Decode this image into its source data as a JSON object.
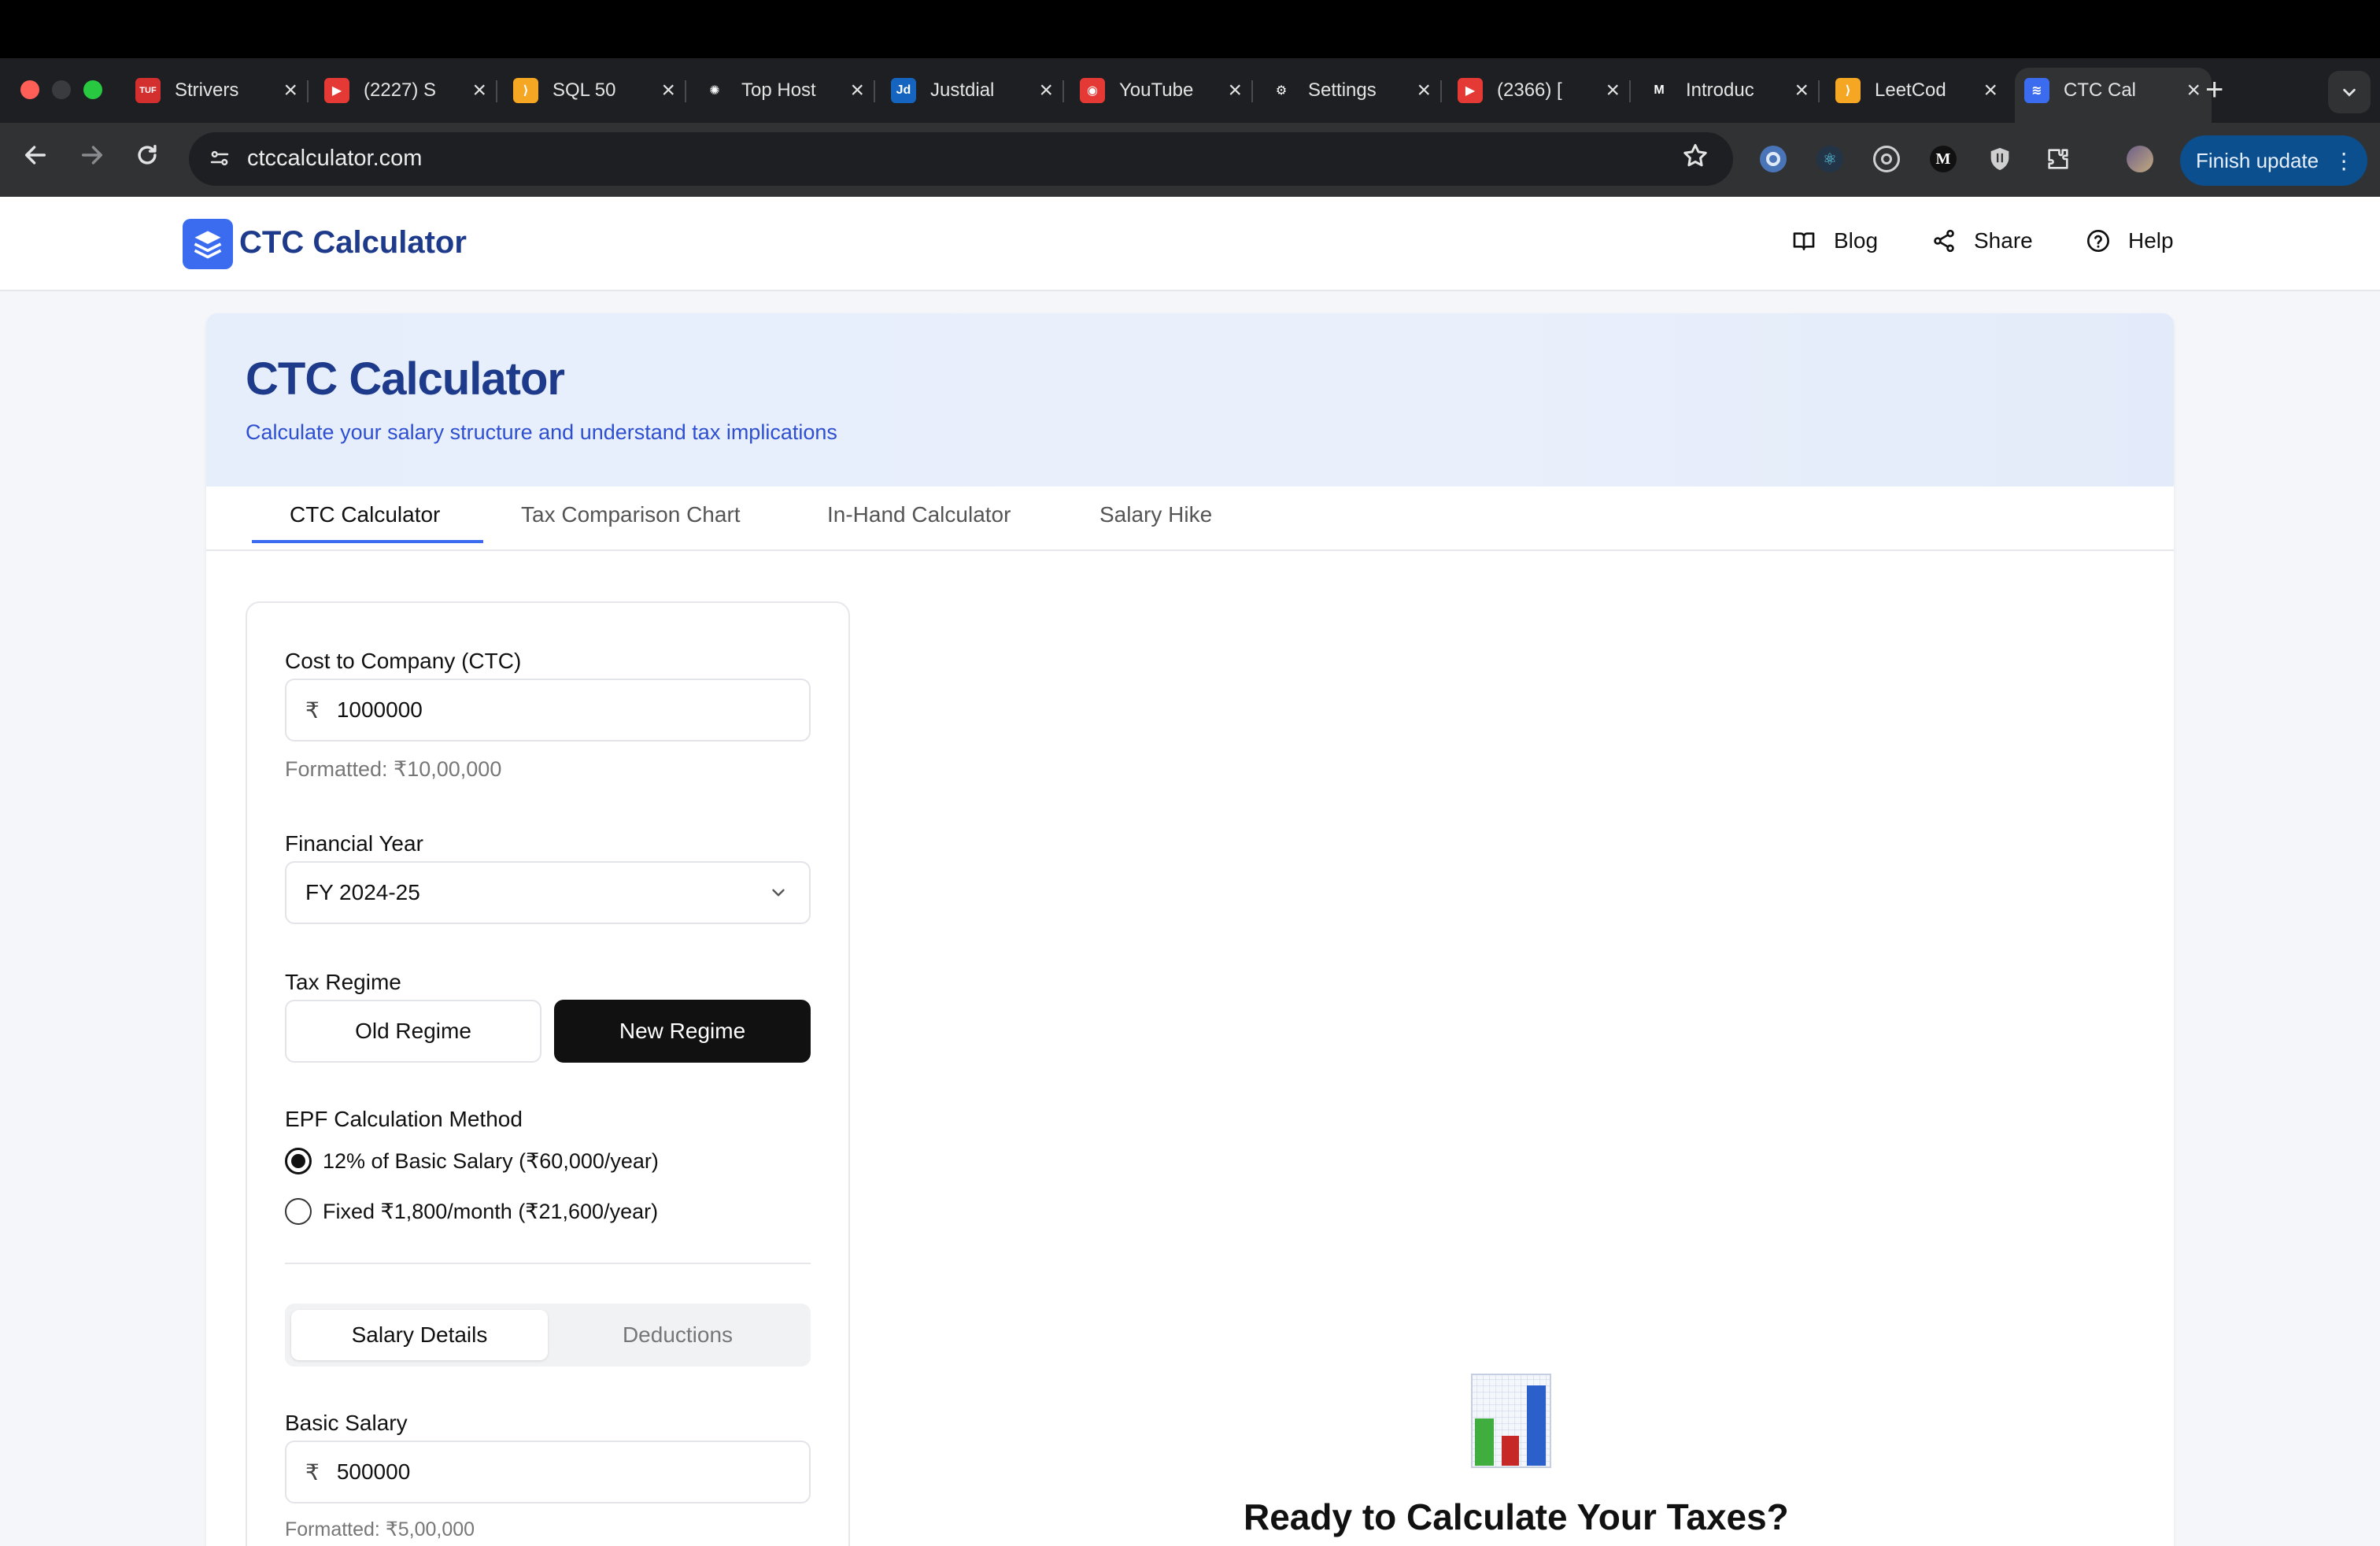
{
  "browser": {
    "tabs": [
      {
        "label": "Strivers",
        "icon": "tuf-icon",
        "color": "#d32f2f"
      },
      {
        "label": "(2227) S",
        "icon": "youtube-icon",
        "color": "#e53935"
      },
      {
        "label": "SQL 50",
        "icon": "leetcode-icon",
        "color": "#f5a623"
      },
      {
        "label": "Top Host",
        "icon": "openai-icon",
        "color": "#ffffff"
      },
      {
        "label": "Justdial",
        "icon": "justdial-icon",
        "color": "#1565c0"
      },
      {
        "label": "YouTube",
        "icon": "youtube-music-icon",
        "color": "#e53935"
      },
      {
        "label": "Settings",
        "icon": "settings-icon",
        "color": "#ffffff"
      },
      {
        "label": "(2366) [",
        "icon": "youtube-icon",
        "color": "#e53935"
      },
      {
        "label": "Introduc",
        "icon": "medium-icon",
        "color": "#ffffff"
      },
      {
        "label": "LeetCod",
        "icon": "leetcode-icon",
        "color": "#f5a623"
      },
      {
        "label": "CTC Cal",
        "icon": "ctc-calculator-icon",
        "color": "#3b6cf0",
        "active": true
      }
    ],
    "url": "ctccalculator.com",
    "finish_update_label": "Finish update"
  },
  "site": {
    "logo_text": "CTC Calculator",
    "nav": {
      "blog": "Blog",
      "share": "Share",
      "help": "Help"
    }
  },
  "hero": {
    "title": "CTC Calculator",
    "subtitle": "Calculate your salary structure and understand tax implications"
  },
  "page_tabs": [
    "CTC Calculator",
    "Tax Comparison Chart",
    "In-Hand Calculator",
    "Salary Hike"
  ],
  "form": {
    "ctc_label": "Cost to Company (CTC)",
    "ctc_value": "1000000",
    "ctc_formatted": "Formatted: ₹10,00,000",
    "currency_symbol": "₹",
    "fy_label": "Financial Year",
    "fy_value": "FY 2024-25",
    "regime_label": "Tax Regime",
    "regime_old": "Old Regime",
    "regime_new": "New Regime",
    "selected_regime": "new",
    "epf_label": "EPF Calculation Method",
    "epf_option_1": "12% of Basic Salary (₹60,000/year)",
    "epf_option_2": "Fixed ₹1,800/month (₹21,600/year)",
    "epf_selected": 1,
    "segment_salary": "Salary Details",
    "segment_deductions": "Deductions",
    "basic_label": "Basic Salary",
    "basic_value": "500000",
    "basic_formatted": "Formatted: ₹5,00,000"
  },
  "empty_state": {
    "icon": "bar-chart-icon",
    "heading": "Ready to Calculate Your Taxes?"
  }
}
